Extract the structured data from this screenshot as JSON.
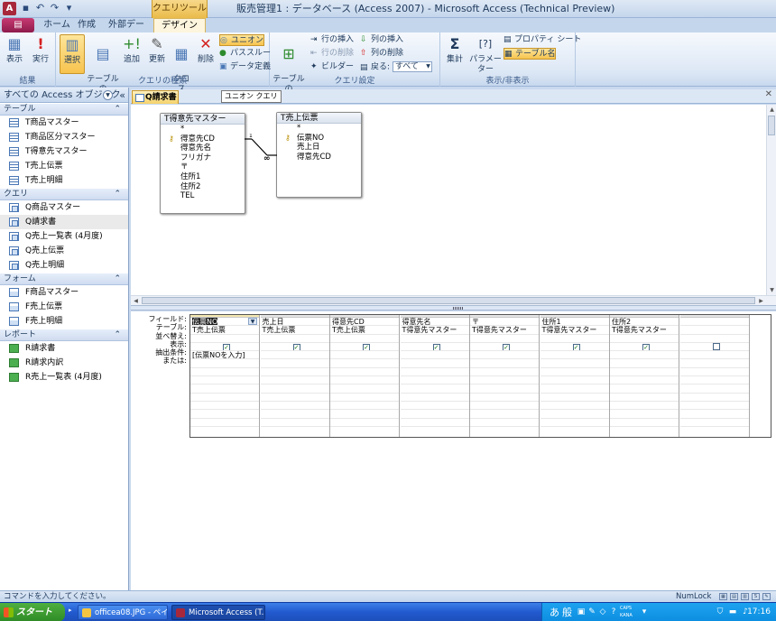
{
  "titlebar": {
    "app_icon": "A",
    "context_tab_group": "クエリツール",
    "window_title": "販売管理1 : データベース (Access 2007) - Microsoft Access (Technical Preview)"
  },
  "tabs": {
    "office_button": "▤",
    "items": [
      {
        "label": "ホーム"
      },
      {
        "label": "作成"
      },
      {
        "label": "外部データ"
      },
      {
        "label": "デザイン"
      }
    ]
  },
  "ribbon": {
    "groups": {
      "results": {
        "label": "結果",
        "view": "表示",
        "run": "実行"
      },
      "query_type": {
        "label": "クエリの種類",
        "select": "選択",
        "make_table": "テーブルの\n作成",
        "append": "追加",
        "update": "更新",
        "crosstab": "クロス\n集計",
        "delete": "削除",
        "union": "ユニオン",
        "pass_through": "パススルー",
        "data_definition": "データ定義"
      },
      "query_setup": {
        "label": "クエリ設定",
        "show_table": "テーブルの\n表示",
        "insert_rows": "行の挿入",
        "delete_rows": "行の削除",
        "builder": "ビルダー",
        "insert_columns": "列の挿入",
        "delete_columns": "列の削除",
        "return_label": "戻る:",
        "return_value": "すべて"
      },
      "show_hide": {
        "label": "表示/非表示",
        "totals": "集計",
        "parameters": "パラメーター",
        "property_sheet": "プロパティ シート",
        "table_names": "テーブル名"
      }
    }
  },
  "nav": {
    "header": "すべての Access オブジェクト",
    "sections": [
      {
        "label": "テーブル",
        "type": "table",
        "items": [
          "T商品マスター",
          "T商品区分マスター",
          "T得意先マスター",
          "T売上伝票",
          "T売上明細"
        ]
      },
      {
        "label": "クエリ",
        "type": "query",
        "items": [
          "Q商品マスター",
          "Q請求書",
          "Q売上一覧表 (4月度)",
          "Q売上伝票",
          "Q売上明細"
        ]
      },
      {
        "label": "フォーム",
        "type": "form",
        "items": [
          "F商品マスター",
          "F売上伝票",
          "F売上明細"
        ]
      },
      {
        "label": "レポート",
        "type": "report",
        "items": [
          "R請求書",
          "R請求内訳",
          "R売上一覧表 (4月度)"
        ]
      }
    ],
    "selected": "Q請求書"
  },
  "doc": {
    "tab_label": "Q請求書",
    "tooltip": "ユニオン クエリ"
  },
  "tables": [
    {
      "title": "T得意先マスター",
      "fields": [
        "*",
        "得意先CD",
        "得意先名",
        "フリガナ",
        "〒",
        "住所1",
        "住所2",
        "TEL"
      ],
      "key_index": 1
    },
    {
      "title": "T売上伝票",
      "fields": [
        "*",
        "伝票NO",
        "売上日",
        "得意先CD"
      ],
      "key_index": 1
    }
  ],
  "relationship": {
    "one": "1",
    "many": "∞"
  },
  "grid": {
    "row_headers": [
      "フィールド:",
      "テーブル:",
      "並べ替え:",
      "表示:",
      "抽出条件:",
      "または:"
    ],
    "columns": [
      {
        "field": "伝票NO",
        "table": "T売上伝票",
        "show": true,
        "criteria": "[伝票NOを入力]"
      },
      {
        "field": "売上日",
        "table": "T売上伝票",
        "show": true,
        "criteria": ""
      },
      {
        "field": "得意先CD",
        "table": "T売上伝票",
        "show": true,
        "criteria": ""
      },
      {
        "field": "得意先名",
        "table": "T得意先マスター",
        "show": true,
        "criteria": ""
      },
      {
        "field": "〒",
        "table": "T得意先マスター",
        "show": true,
        "criteria": ""
      },
      {
        "field": "住所1",
        "table": "T得意先マスター",
        "show": true,
        "criteria": ""
      },
      {
        "field": "住所2",
        "table": "T得意先マスター",
        "show": true,
        "criteria": ""
      },
      {
        "field": "",
        "table": "",
        "show": false,
        "criteria": ""
      }
    ]
  },
  "statusbar": {
    "message": "コマンドを入力してください。",
    "numlock": "NumLock"
  },
  "taskbar": {
    "start": "スタート",
    "tasks": [
      {
        "label": "officea08.JPG - ペイ..."
      },
      {
        "label": "Microsoft Access (T..."
      }
    ],
    "ime": "あ",
    "ime_mode": "般",
    "caps": "CAPS",
    "kana": "KANA",
    "clock": "17:16"
  }
}
